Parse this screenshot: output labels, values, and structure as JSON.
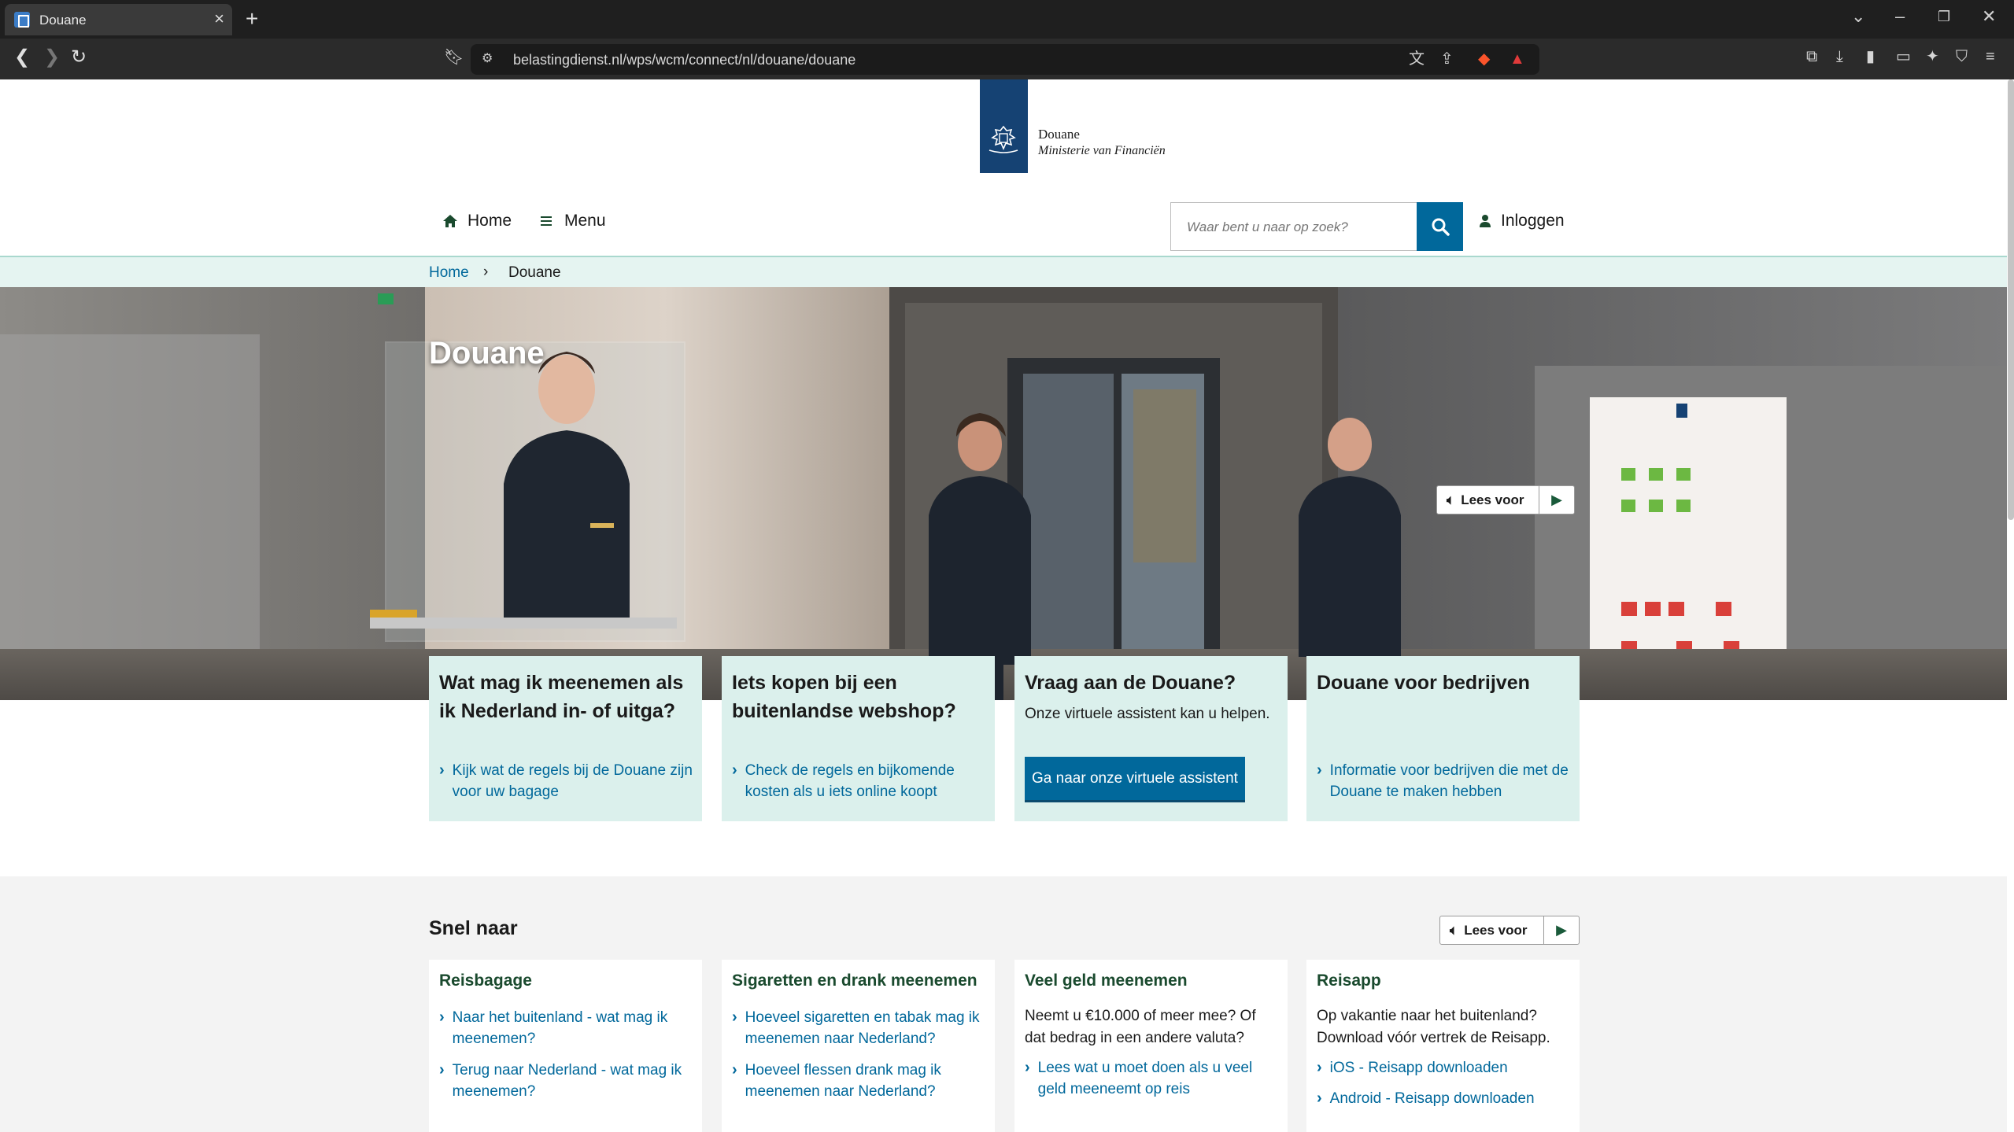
{
  "browser": {
    "tab_title": "Douane",
    "url": "belastingdienst.nl/wps/wcm/connect/nl/douane/douane"
  },
  "header": {
    "logo_title": "Douane",
    "logo_subtitle": "Ministerie van Financiën",
    "nav_home": "Home",
    "nav_menu": "Menu",
    "search_placeholder": "Waar bent u naar op zoek?",
    "login": "Inloggen"
  },
  "breadcrumb": {
    "home": "Home",
    "current": "Douane"
  },
  "hero": {
    "title": "Douane",
    "read_aloud": "Lees voor"
  },
  "cards": [
    {
      "title": "Wat mag ik meenemen als ik Nederland in- of uitga?",
      "link": "Kijk wat de regels bij de Douane zijn voor uw bagage"
    },
    {
      "title": "Iets kopen bij een buitenlandse webshop?",
      "link": "Check de regels en bijkomende kosten als u iets online koopt"
    },
    {
      "title": "Vraag aan de Douane?",
      "text": "Onze virtuele assistent kan u helpen.",
      "button": "Ga naar onze virtuele assistent"
    },
    {
      "title": "Douane voor bedrijven",
      "link": "Informatie voor bedrijven die met de Douane te maken hebben"
    }
  ],
  "snel_naar": {
    "title": "Snel naar",
    "read_aloud": "Lees voor",
    "columns": [
      {
        "title": "Reisbagage",
        "links": [
          "Naar het buitenland - wat mag ik meenemen?",
          "Terug naar Nederland - wat mag ik meenemen?"
        ]
      },
      {
        "title": "Sigaretten en drank meenemen",
        "links": [
          "Hoeveel sigaretten en tabak mag ik meenemen naar Nederland?",
          "Hoeveel flessen drank mag ik meenemen naar Nederland?"
        ]
      },
      {
        "title": "Veel geld meenemen",
        "text": "Neemt u €10.000 of meer mee? Of dat bedrag in een andere valuta?",
        "links": [
          "Lees wat u moet doen als u veel geld meeneemt op reis"
        ]
      },
      {
        "title": "Reisapp",
        "text": "Op vakantie naar het buitenland? Download vóór vertrek de Reisapp.",
        "links": [
          "iOS - Reisapp downloaden",
          "Android - Reisapp downloaden"
        ]
      }
    ]
  },
  "colors": {
    "brand_blue": "#154273",
    "link_blue": "#01689b",
    "card_mint": "#dbf0ec",
    "breadcrumb_mint": "#e5f4f1"
  }
}
